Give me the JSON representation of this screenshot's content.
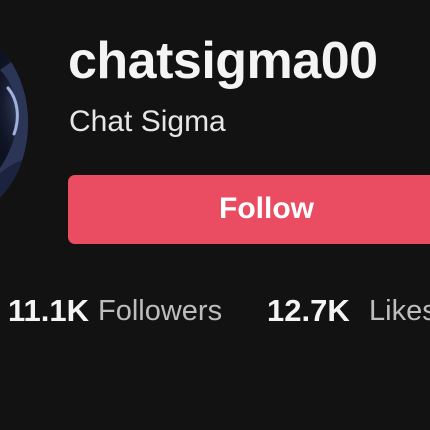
{
  "profile": {
    "username": "chatsigma00",
    "display_name": "Chat Sigma",
    "avatar_icon": "profile-avatar"
  },
  "actions": {
    "follow_label": "Follow",
    "follow_color": "#ea4d62"
  },
  "stats": {
    "followers_count": "11.1K",
    "followers_label": "Followers",
    "likes_count": "12.7K",
    "likes_label": "Likes"
  }
}
